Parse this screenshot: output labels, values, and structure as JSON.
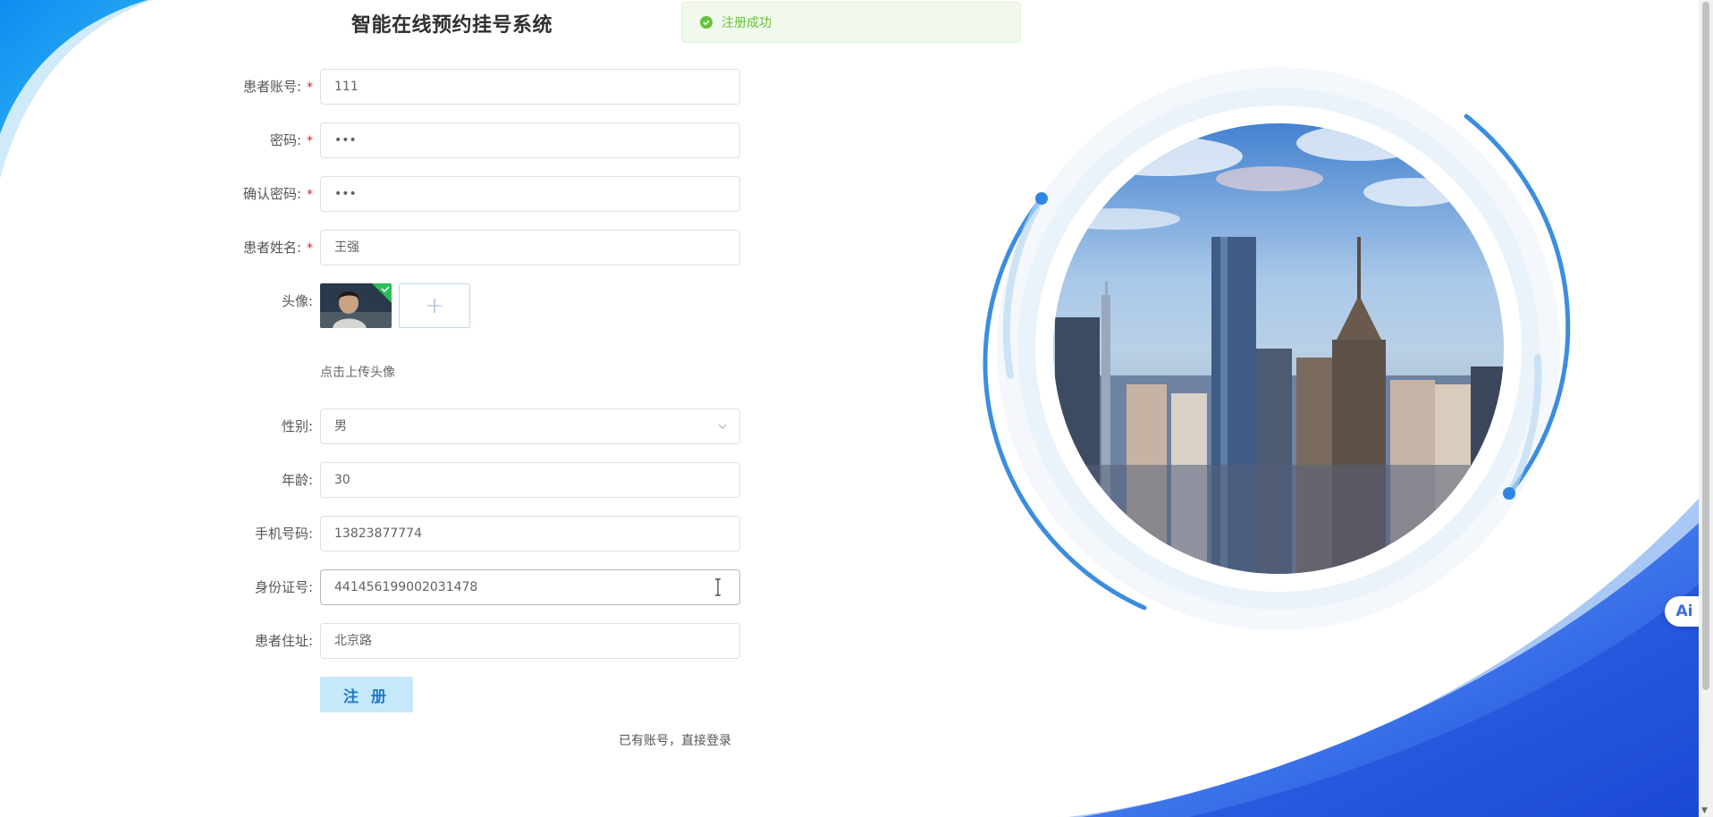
{
  "page": {
    "title": "智能在线预约挂号系统"
  },
  "toast": {
    "message": "注册成功",
    "icon": "check-circle-icon",
    "color": "#67c23a"
  },
  "form": {
    "account": {
      "label": "患者账号:",
      "required": "*",
      "value": "111"
    },
    "password": {
      "label": "密码:",
      "required": "*",
      "value": "•••"
    },
    "confirm_password": {
      "label": "确认密码:",
      "required": "*",
      "value": "•••"
    },
    "name": {
      "label": "患者姓名:",
      "required": "*",
      "value": "王强"
    },
    "avatar": {
      "label": "头像:",
      "upload_icon": "+",
      "hint": "点击上传头像"
    },
    "gender": {
      "label": "性别:",
      "value": "男"
    },
    "age": {
      "label": "年龄:",
      "value": "30"
    },
    "phone": {
      "label": "手机号码:",
      "value": "13823877774"
    },
    "id_card": {
      "label": "身份证号:",
      "value": "441456199002031478"
    },
    "address": {
      "label": "患者住址:",
      "value": "北京路"
    },
    "submit_label": "注 册",
    "login_link": "已有账号，直接登录"
  },
  "ai_badge": {
    "label": "Ai"
  },
  "colors": {
    "accent": "#1e79c9",
    "button_bg": "#c6e8fb",
    "wave_blue": "#1a5fe0"
  }
}
